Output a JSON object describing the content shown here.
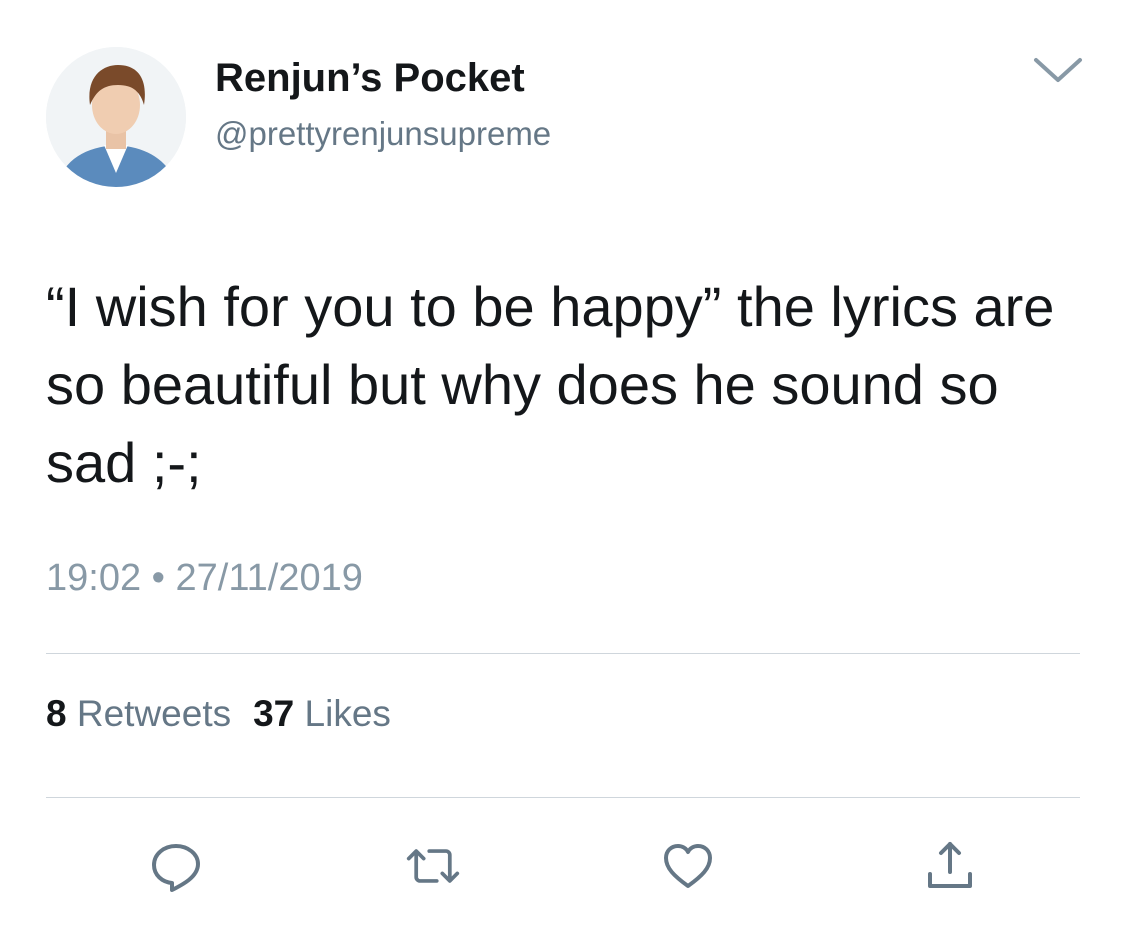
{
  "author": {
    "display_name": "Renjun’s Pocket",
    "handle": "@prettyrenjunsupreme"
  },
  "tweet": {
    "text": "“I wish for you to be happy” the lyrics are so beautiful but why does he sound so sad ;-;",
    "time": "19:02",
    "separator": "•",
    "date": "27/11/2019"
  },
  "stats": {
    "retweets_count": "8",
    "retweets_label": "Retweets",
    "likes_count": "37",
    "likes_label": "Likes"
  },
  "icons": {
    "menu": "chevron-down-icon",
    "reply": "reply-icon",
    "retweet": "retweet-icon",
    "like": "heart-icon",
    "share": "share-icon"
  },
  "colors": {
    "text_primary": "#14171a",
    "text_secondary": "#657786",
    "timestamp": "#8899a6",
    "icon": "#657786",
    "divider": "#cfd6dc"
  }
}
